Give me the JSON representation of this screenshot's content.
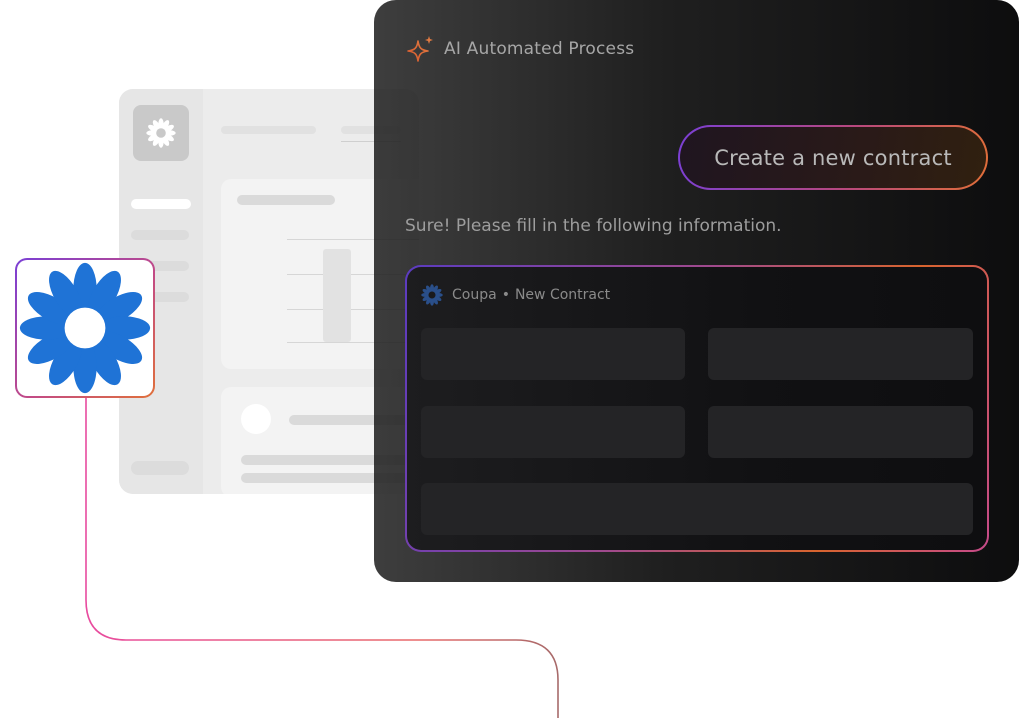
{
  "ai_panel": {
    "title": "AI Automated Process",
    "user_message": "Create a new contract",
    "assistant_reply": "Sure! Please fill in the following information.",
    "form": {
      "source": "Coupa",
      "separator": "•",
      "title": "New Contract"
    }
  },
  "integration": {
    "logo_icon": "coupa-logo-icon"
  },
  "colors": {
    "coupa_blue": "#1f73d6",
    "gradient_purple": "#7a3fd6",
    "gradient_pink": "#d8539c",
    "gradient_orange": "#e0703a",
    "panel_dark": "#111113"
  }
}
